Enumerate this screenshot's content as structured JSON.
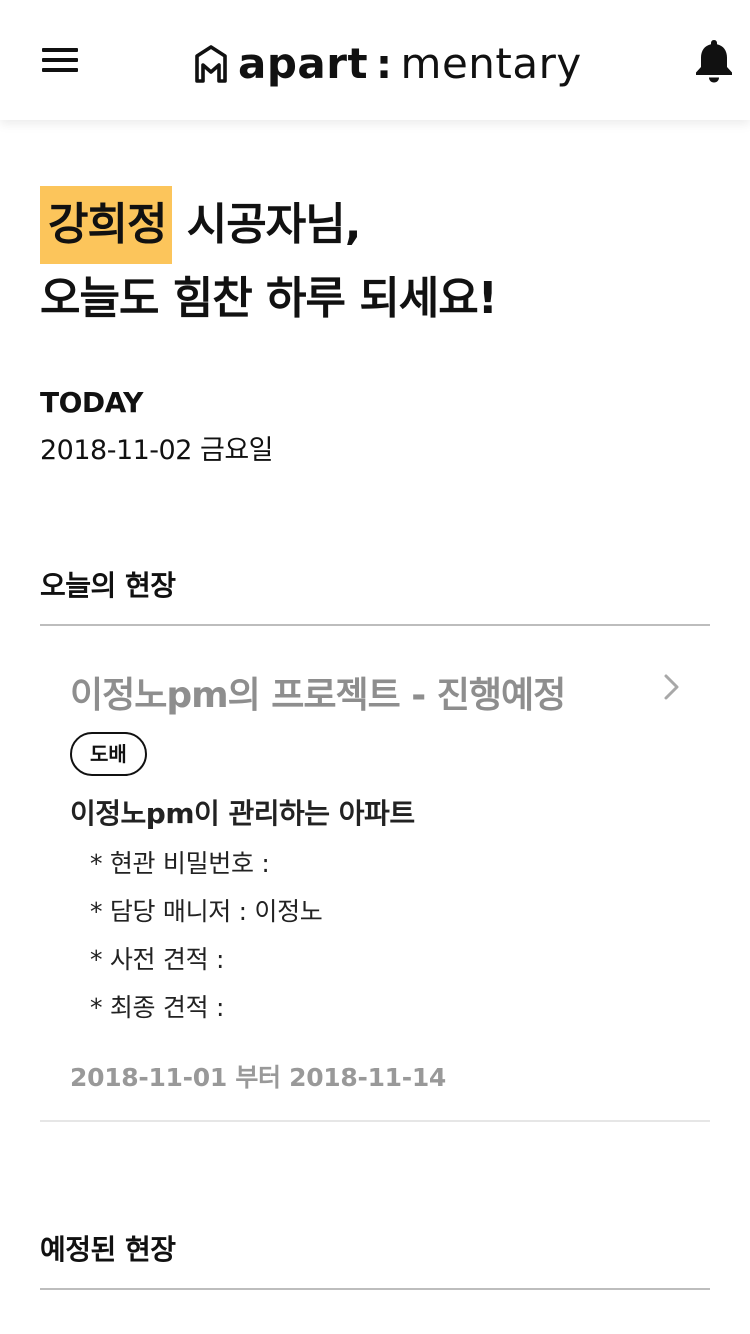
{
  "header": {
    "logo_left": "apart",
    "logo_colon": ":",
    "logo_right": "mentary"
  },
  "greeting": {
    "name": "강희정",
    "suffix": "시공자님,",
    "line2": "오늘도 힘찬 하루 되세요!"
  },
  "today": {
    "label": "TODAY",
    "date": "2018-11-02 금요일"
  },
  "sections": {
    "today_sites": "오늘의 현장",
    "scheduled_sites": "예정된 현장"
  },
  "card": {
    "title": "이정노pm의 프로젝트 - 진행예정",
    "tag": "도배",
    "apartment": "이정노pm이 관리하는 아파트",
    "details": [
      "* 현관 비밀번호 :",
      "* 담당 매니저 : 이정노",
      "* 사전 견적 :",
      "* 최종 견적 :"
    ],
    "period": "2018-11-01 부터 2018-11-14"
  },
  "colors": {
    "highlight": "#fcc55b",
    "muted_text": "#8e8e8e",
    "divider": "#bdbdbd"
  },
  "icons": {
    "menu": "hamburger-icon",
    "bell": "bell-icon",
    "chevron": "chevron-right-icon",
    "logo": "house-logo-icon"
  }
}
